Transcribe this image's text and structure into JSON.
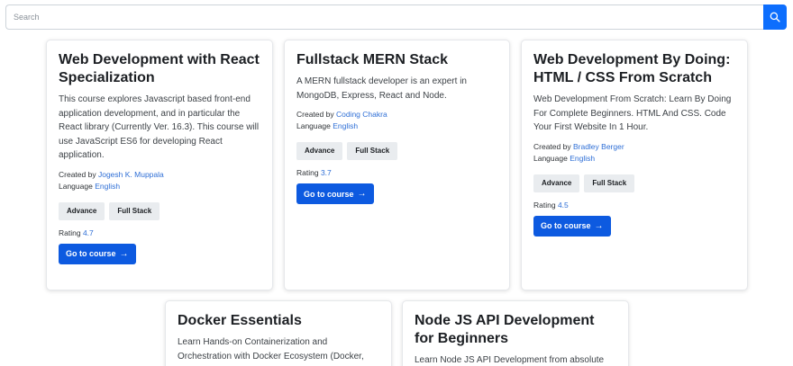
{
  "search": {
    "placeholder": "Search",
    "icon": "search-icon",
    "accent": "#0d6efd"
  },
  "labels": {
    "created_by": "Created by",
    "language": "Language",
    "rating": "Rating",
    "go_button": "Go to course",
    "go_arrow": "→"
  },
  "courses": [
    {
      "title": "Web Development with React Specialization",
      "description": "This course explores Javascript based front-end application development, and in particular the React library (Currently Ver. 16.3). This course will use JavaScript ES6 for developing React application.",
      "author": "Jogesh K. Muppala",
      "language": "English",
      "tags": [
        "Advance",
        "Full Stack"
      ],
      "rating": "4.7"
    },
    {
      "title": "Fullstack MERN Stack",
      "description": "A MERN fullstack developer is an expert in MongoDB, Express, React and Node.",
      "author": "Coding Chakra",
      "language": "English",
      "tags": [
        "Advance",
        "Full Stack"
      ],
      "rating": "3.7"
    },
    {
      "title": "Web Development By Doing: HTML / CSS From Scratch",
      "description": "Web Development From Scratch: Learn By Doing For Complete Beginners. HTML And CSS. Code Your First Website In 1 Hour.",
      "author": "Bradley Berger",
      "language": "English",
      "tags": [
        "Advance",
        "Full Stack"
      ],
      "rating": "4.5"
    },
    {
      "title": "Docker Essentials",
      "description": "Learn Hands-on Containerization and Orchestration with Docker Ecosystem (Docker,"
    },
    {
      "title": "Node JS API Development for Beginners",
      "description": "Learn Node JS API Development from absolute"
    }
  ]
}
